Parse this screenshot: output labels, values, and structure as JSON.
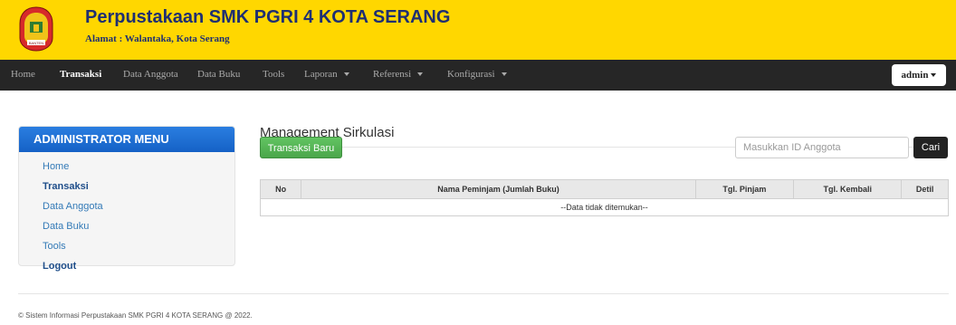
{
  "header": {
    "title": "Perpustakaan SMK PGRI 4 KOTA SERANG",
    "address": "Alamat : Walantaka, Kota Serang",
    "logo_text": "BANTEN"
  },
  "nav": {
    "items": [
      {
        "label": "Home",
        "active": false
      },
      {
        "label": "Transaksi",
        "active": true
      },
      {
        "label": "Data Anggota",
        "active": false
      },
      {
        "label": "Data Buku",
        "active": false
      },
      {
        "label": "Tools",
        "active": false
      },
      {
        "label": "Laporan",
        "dropdown": true
      },
      {
        "label": "Referensi",
        "dropdown": true
      },
      {
        "label": "Konfigurasi",
        "dropdown": true
      }
    ],
    "user": "admin"
  },
  "sidebar": {
    "title": "ADMINISTRATOR MENU",
    "items": [
      {
        "label": "Home"
      },
      {
        "label": "Transaksi"
      },
      {
        "label": "Data Anggota"
      },
      {
        "label": "Data Buku"
      },
      {
        "label": "Tools"
      },
      {
        "label": "Logout"
      }
    ]
  },
  "main": {
    "title": "Management Sirkulasi",
    "new_button": "Transaksi Baru",
    "search_placeholder": "Masukkan ID Anggota",
    "search_button": "Cari",
    "table": {
      "headers": [
        "No",
        "Nama Peminjam (Jumlah Buku)",
        "Tgl. Pinjam",
        "Tgl. Kembali",
        "Detil"
      ],
      "empty_text": "--Data tidak ditemukan--"
    }
  },
  "footer": {
    "text": "© Sistem Informasi Perpustakaan SMK PGRI 4 KOTA SERANG @ 2022."
  },
  "colors": {
    "header_bg": "#ffd700",
    "navbar_bg": "#262626",
    "title_text": "#1f2f72",
    "sidebar_title": "#1a6bd6",
    "link": "#337ab7",
    "success": "#5cb85c"
  }
}
